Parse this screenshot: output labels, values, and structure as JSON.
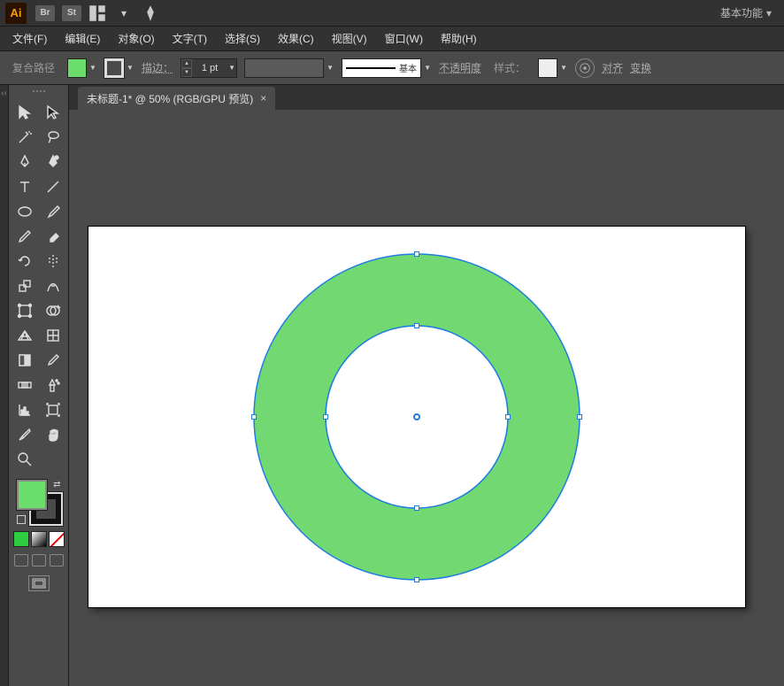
{
  "app": {
    "workspace_label": "基本功能"
  },
  "menu": {
    "file": "文件(F)",
    "edit": "编辑(E)",
    "object": "对象(O)",
    "type": "文字(T)",
    "select": "选择(S)",
    "effect": "效果(C)",
    "view": "视图(V)",
    "window": "窗口(W)",
    "help": "帮助(H)"
  },
  "control": {
    "selection_kind": "复合路径",
    "stroke_label": "描边：",
    "stroke_width": "1 pt",
    "brush_label": "基本",
    "opacity_label": "不透明度",
    "style_label": "样式：",
    "align_label": "对齐",
    "transform_label": "变换",
    "fill_color": "#6bdd6b"
  },
  "document": {
    "tab_title": "未标题-1* @ 50% (RGB/GPU 预览)",
    "tab_close": "×"
  },
  "shape": {
    "fill": "#72d972",
    "stroke": "#1d7de0",
    "outer_radius": 184,
    "inner_radius": 103
  }
}
